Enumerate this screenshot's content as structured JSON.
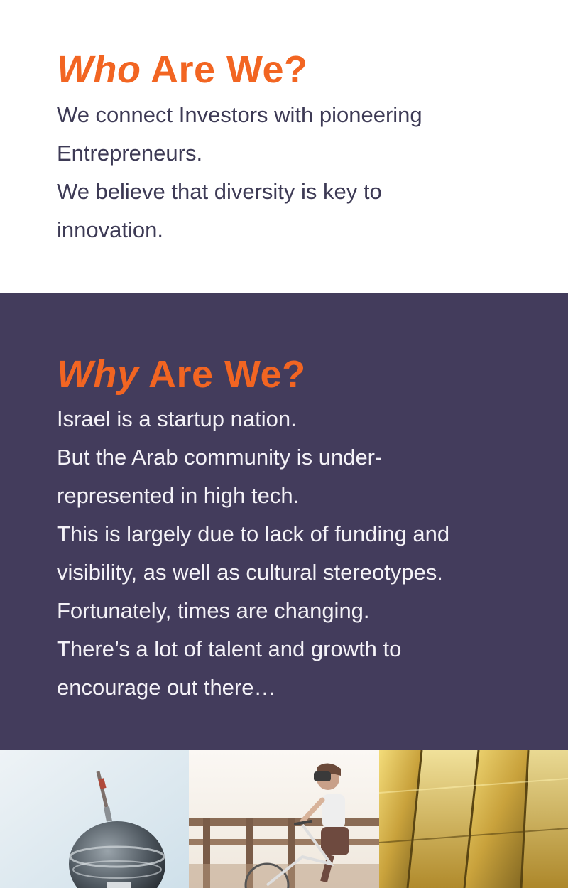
{
  "colors": {
    "accent": "#f26522",
    "who_text": "#3d3a55",
    "why_background": "#433c5c",
    "why_text": "#f4f2f7"
  },
  "who": {
    "heading_italic": "Who",
    "heading_rest": " Are We?",
    "lines": [
      "We connect Investors with pioneering",
      "Entrepreneurs.",
      "We believe that diversity is key to",
      "innovation."
    ]
  },
  "why": {
    "heading_italic": "Why",
    "heading_rest": " Are We?",
    "lines": [
      "Israel is a startup nation.",
      "But the Arab community is under-",
      "represented in high tech.",
      "This is largely due to lack of funding and",
      "visibility, as well as cultural stereotypes.",
      "Fortunately, times are changing.",
      "There’s a lot of talent and growth to",
      "encourage out there…"
    ]
  },
  "photos": [
    {
      "icon": "tv-tower-image"
    },
    {
      "icon": "vr-cyclist-image"
    },
    {
      "icon": "gold-bars-image"
    }
  ]
}
